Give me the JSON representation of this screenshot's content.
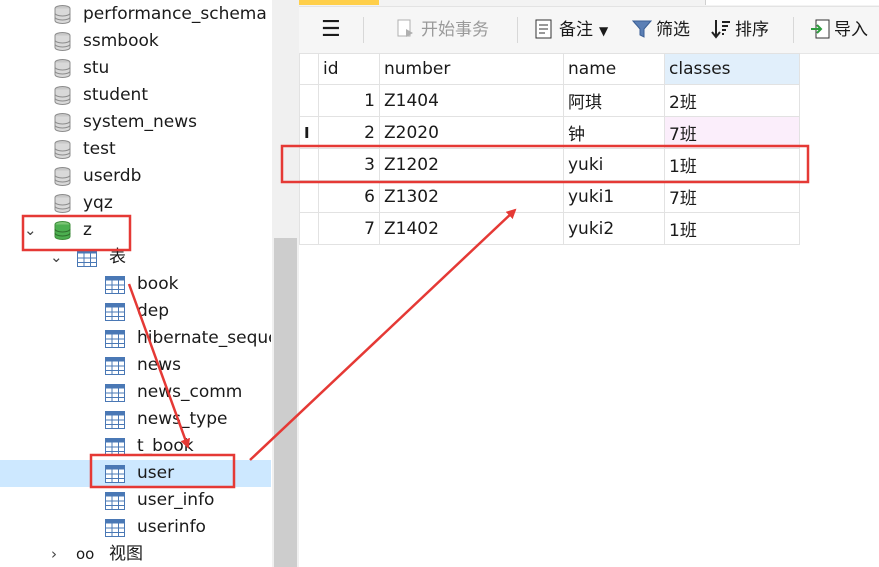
{
  "tree": {
    "databases": [
      "performance_schema",
      "ssmbook",
      "stu",
      "student",
      "system_news",
      "test",
      "userdb",
      "yqz"
    ],
    "open_db": "z",
    "tables_folder": "表",
    "tables": [
      "book",
      "dep",
      "hibernate_sequence",
      "news",
      "news_comm",
      "news_type",
      "t_book",
      "user",
      "user_info",
      "userinfo"
    ],
    "selected_table": "user",
    "views_folder": "视图"
  },
  "toolbar": {
    "begin_transaction": "开始事务",
    "notes": "备注",
    "filter": "筛选",
    "sort": "排序",
    "import": "导入"
  },
  "grid": {
    "columns": [
      "id",
      "number",
      "name",
      "classes"
    ],
    "rows": [
      {
        "id": "1",
        "number": "Z1404",
        "name": "阿琪",
        "classes": "2班"
      },
      {
        "id": "2",
        "number": "Z2020",
        "name": "钟",
        "classes": "7班"
      },
      {
        "id": "3",
        "number": "Z1202",
        "name": "yuki",
        "classes": "1班"
      },
      {
        "id": "6",
        "number": "Z1302",
        "name": "yuki1",
        "classes": "7班"
      },
      {
        "id": "7",
        "number": "Z1402",
        "name": "yuki2",
        "classes": "1班"
      }
    ],
    "row_marker": "I"
  },
  "colors": {
    "selection": "#cde8ff",
    "annotation_red": "#e53935",
    "db_icon_active": "#4caf50"
  }
}
